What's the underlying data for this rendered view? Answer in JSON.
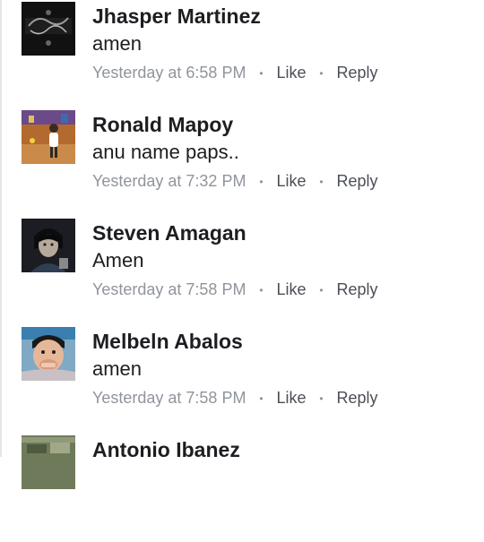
{
  "comments": [
    {
      "name": "Jhasper Martinez",
      "text": "amen",
      "time": "Yesterday at 6:58 PM",
      "like_label": "Like",
      "reply_label": "Reply"
    },
    {
      "name": "Ronald Mapoy",
      "text": "anu name paps..",
      "time": "Yesterday at 7:32 PM",
      "like_label": "Like",
      "reply_label": "Reply"
    },
    {
      "name": "Steven Amagan",
      "text": "Amen",
      "time": "Yesterday at 7:58 PM",
      "like_label": "Like",
      "reply_label": "Reply"
    },
    {
      "name": "Melbeln Abalos",
      "text": "amen",
      "time": "Yesterday at 7:58 PM",
      "like_label": "Like",
      "reply_label": "Reply"
    },
    {
      "name": "Antonio Ibanez"
    }
  ],
  "separator": "•"
}
